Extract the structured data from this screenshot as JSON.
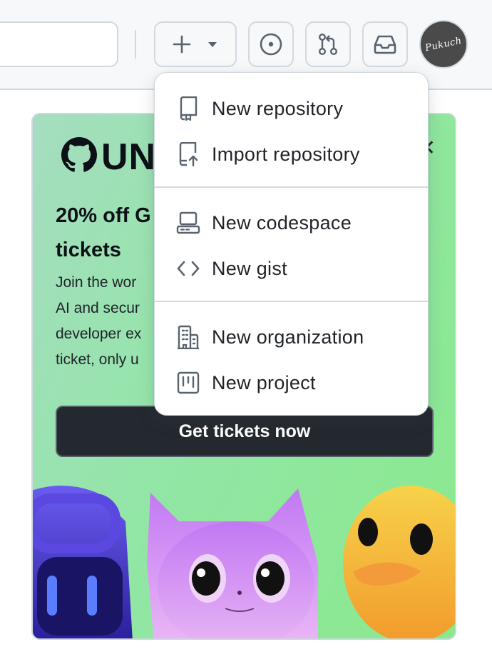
{
  "header": {
    "create_button": {
      "icon": "plus-icon",
      "caret": "triangle-down-icon"
    },
    "issues_button": {
      "icon": "issue-opened-icon"
    },
    "pulls_button": {
      "icon": "git-pull-request-icon"
    },
    "inbox_button": {
      "icon": "inbox-icon"
    },
    "avatar": {
      "signature": "Pukuch"
    }
  },
  "menu": {
    "groups": [
      [
        {
          "label": "New repository",
          "icon": "repo-icon"
        },
        {
          "label": "Import repository",
          "icon": "repo-push-icon"
        }
      ],
      [
        {
          "label": "New codespace",
          "icon": "codespaces-icon"
        },
        {
          "label": "New gist",
          "icon": "code-icon"
        }
      ],
      [
        {
          "label": "New organization",
          "icon": "organization-icon"
        },
        {
          "label": "New project",
          "icon": "project-icon"
        }
      ]
    ]
  },
  "promo": {
    "logo_text": "UN",
    "heading": "20% off G\ntickets",
    "body": "Join the wor\nAI and secur\ndeveloper ex\nticket, only u",
    "cta_label": "Get tickets now",
    "close_icon": "close-icon"
  },
  "colors": {
    "header_bg": "#f6f8fa",
    "border": "#d1d9e0",
    "promo_gradient_start": "#a5ddc0",
    "promo_gradient_end": "#8ae98c",
    "cta_bg": "#24292f",
    "avatar_bg": "#4a4a4a"
  }
}
